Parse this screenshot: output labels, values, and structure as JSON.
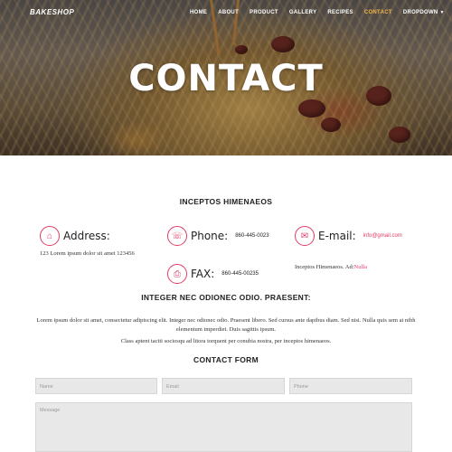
{
  "navbar": {
    "brand": "BAKESHOP",
    "items": [
      {
        "label": "HOME"
      },
      {
        "label": "ABOUT"
      },
      {
        "label": "PRODUCT"
      },
      {
        "label": "GALLERY"
      },
      {
        "label": "RECIPES"
      },
      {
        "label": "CONTACT",
        "active": true
      },
      {
        "label": "DROPDOWN",
        "has_caret": true
      }
    ]
  },
  "hero": {
    "title": "CONTACT"
  },
  "contact_info": {
    "heading": "INCEPTOS HIMENAEOS",
    "address": {
      "label": "Address:",
      "value": "123 Lorem ipsum dolor sit amet 123456",
      "icon": "home-icon"
    },
    "phone": {
      "label": "Phone:",
      "value": "860-445-0023",
      "icon": "phone-icon"
    },
    "email": {
      "label": "E-mail:",
      "value": "info@gmail.com",
      "icon": "envelope-icon"
    },
    "fax": {
      "label": "FAX:",
      "value": "860-445-00235",
      "icon": "fax-icon"
    },
    "note_prefix": "Inceptos Himenaeos. Ad:",
    "note_link": "Nulla"
  },
  "about": {
    "heading": "INTEGER NEC ODIONEC ODIO. PRAESENT:",
    "paragraph1": "Lorem ipsum dolor sit amet, consectetur adipiscing elit. Integer nec odionec odio. Praesent libero. Sed cursus ante dapibus diam. Sed nisi. Nulla quis sem at nibh elementum imperdiet. Duis sagittis ipsum.",
    "paragraph2": "Class aptent taciti sociosqu ad litora torquent per conubia nostra, per inceptos himenaeos."
  },
  "form": {
    "heading": "CONTACT FORM",
    "name_placeholder": "Name",
    "email_placeholder": "Email",
    "phone_placeholder": "Phone",
    "message_placeholder": "Message"
  },
  "colors": {
    "accent": "#e23b64",
    "nav_active": "#f5b74a"
  }
}
